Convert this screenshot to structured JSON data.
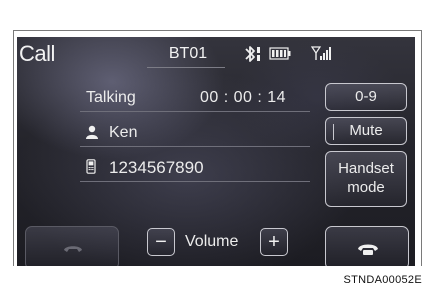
{
  "header": {
    "title": "Call",
    "device_name": "BT01",
    "icons": [
      "bluetooth-icon",
      "battery-icon",
      "signal-strength-icon"
    ]
  },
  "call_info": {
    "status": "Talking",
    "elapsed_time": "00 : 00 : 14",
    "contact_name": "Ken",
    "phone_number": "1234567890"
  },
  "side_buttons": {
    "keypad": "0-9",
    "mute": "Mute",
    "handset_line1": "Handset",
    "handset_line2": "mode"
  },
  "bottom_bar": {
    "volume_label": "Volume",
    "volume_down": "−",
    "volume_up": "+"
  },
  "reference_code": "STNDA00052E",
  "colors": {
    "screen_background": "#25252c",
    "text": "#ececec",
    "button_border": "#c8c8cf"
  }
}
